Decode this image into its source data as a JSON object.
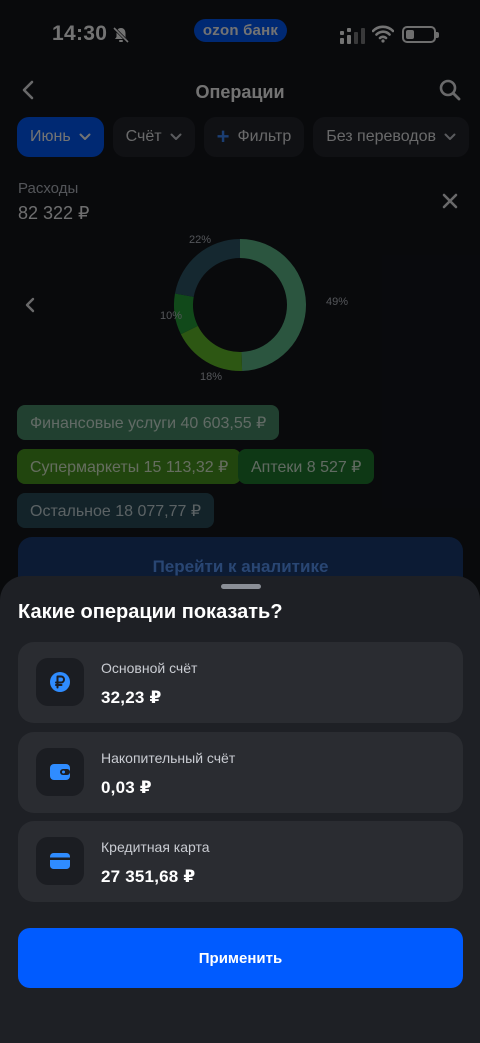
{
  "status_bar": {
    "time": "14:30",
    "center_pill": "ozon банк"
  },
  "nav": {
    "title": "Операции"
  },
  "filters": [
    {
      "label": "Июнь",
      "active": true,
      "has_chevron": true,
      "has_plus": false
    },
    {
      "label": "Счёт",
      "active": false,
      "has_chevron": true,
      "has_plus": false
    },
    {
      "label": "Фильтр",
      "active": false,
      "has_chevron": false,
      "has_plus": true
    },
    {
      "label": "Без переводов",
      "active": false,
      "has_chevron": true,
      "has_plus": false
    }
  ],
  "expenses": {
    "label": "Расходы",
    "value": "82 322 ₽"
  },
  "chart_data": {
    "type": "pie",
    "categories": [
      "Финансовые услуги",
      "Супермаркеты",
      "Аптеки",
      "Остальное"
    ],
    "values": [
      49,
      18,
      10,
      22
    ],
    "value_labels": [
      "49%",
      "18%",
      "10%",
      "22%"
    ],
    "colors": [
      "#5fbd8d",
      "#64c22b",
      "#27a33a",
      "#2f5a6a"
    ]
  },
  "legend": [
    {
      "text": "Финансовые услуги 40 603,55 ₽",
      "bg": "#4a8f6a",
      "fg": "#d7ecdf"
    },
    {
      "text": "Супермаркеты 15 113,32 ₽",
      "bg": "#4b9a21",
      "fg": "#e0f2d2"
    },
    {
      "text": "Аптеки 8 527 ₽",
      "bg": "#1f7c30",
      "fg": "#d5ecd7"
    },
    {
      "text": "Остальное 18 077,77 ₽",
      "bg": "#2a4f5c",
      "fg": "#cad9de"
    }
  ],
  "analytics_button": {
    "label": "Перейти к аналитике"
  },
  "sheet": {
    "title": "Какие операции показать?",
    "accounts": [
      {
        "name": "Основной счёт",
        "amount": "32,23 ₽",
        "icon": "ruble-icon"
      },
      {
        "name": "Накопительный счёт",
        "amount": "0,03 ₽",
        "icon": "wallet-icon"
      },
      {
        "name": "Кредитная карта",
        "amount": "27 351,68 ₽",
        "icon": "credit-card-icon"
      }
    ],
    "apply_label": "Применить"
  },
  "colors": {
    "accent": "#005bff",
    "icon_blue": "#2f8cff",
    "sheet_bg": "#1e2025",
    "card_bg": "#2a2c31"
  }
}
